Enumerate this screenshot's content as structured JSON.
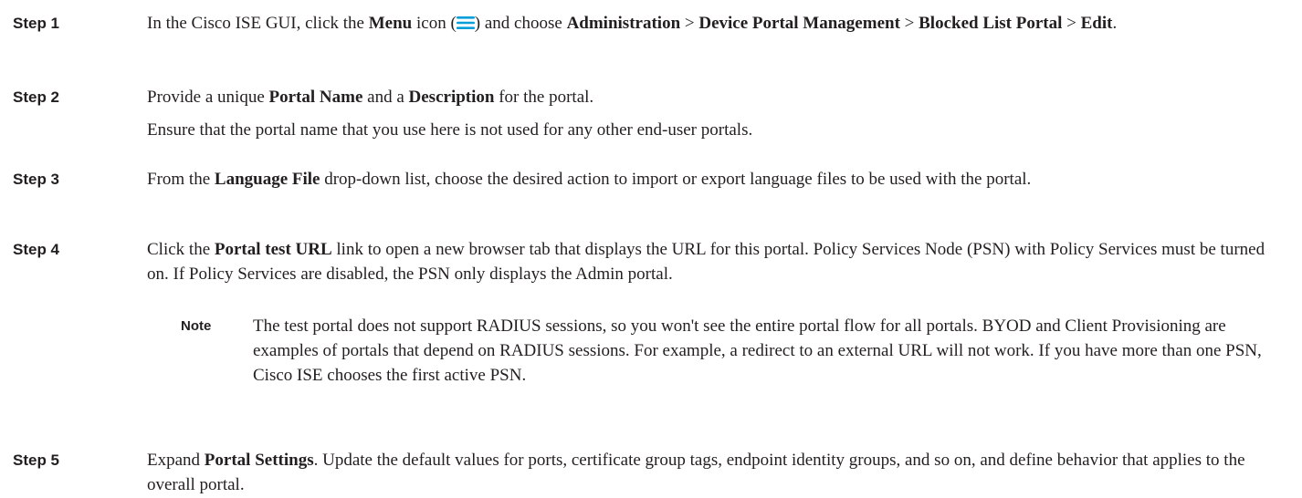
{
  "steps": [
    {
      "label": "Step 1",
      "t1": "In the Cisco ISE GUI, click the ",
      "b1": "Menu",
      "t2": " icon (",
      "t3": ") and choose ",
      "b2": "Administration",
      "sep1": " > ",
      "b3": "Device Portal Management",
      "sep2": " > ",
      "b4": "Blocked List Portal",
      "sep3": " > ",
      "b5": "Edit",
      "t4": "."
    },
    {
      "label": "Step 2",
      "t1": "Provide a unique ",
      "b1": "Portal Name",
      "t2": " and a ",
      "b2": "Description",
      "t3": " for the portal.",
      "p2": "Ensure that the portal name that you use here is not used for any other end-user portals."
    },
    {
      "label": "Step 3",
      "t1": "From the ",
      "b1": "Language File",
      "t2": " drop-down list, choose the desired action to import or export language files to be used with the portal."
    },
    {
      "label": "Step 4",
      "t1": "Click the ",
      "b1": "Portal test URL",
      "t2": " link to open a new browser tab that displays the URL for this portal. Policy Services Node (PSN) with Policy Services must be turned on. If Policy Services are disabled, the PSN only displays the Admin portal.",
      "note_label": "Note",
      "note_text": "The test portal does not support RADIUS sessions, so you won't see the entire portal flow for all portals. BYOD and Client Provisioning are examples of portals that depend on RADIUS sessions. For example, a redirect to an external URL will not work. If you have more than one PSN, Cisco ISE chooses the first active PSN."
    },
    {
      "label": "Step 5",
      "t1": "Expand ",
      "b1": "Portal Settings",
      "t2": ". Update the default values for ports, certificate group tags, endpoint identity groups, and so on, and define behavior that applies to the overall portal."
    }
  ],
  "colors": {
    "menu_icon": "#049fd9",
    "text": "#231f20"
  },
  "icons": {
    "menu": "hamburger-menu-icon"
  }
}
